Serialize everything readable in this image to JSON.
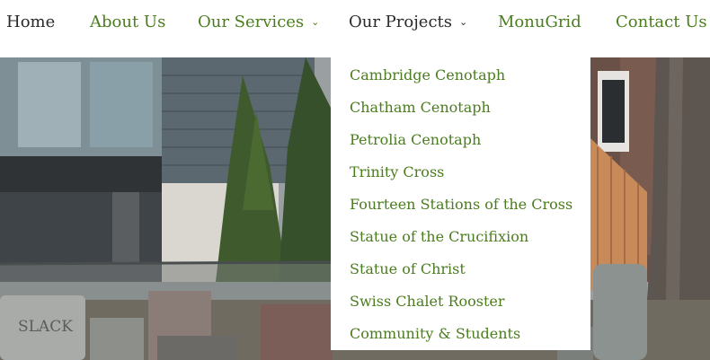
{
  "colors": {
    "accent_green": "#4b7d1e",
    "text_dark": "#2a2a2a",
    "background": "#ffffff"
  },
  "nav": {
    "items": [
      {
        "label": "Home",
        "has_dropdown": false
      },
      {
        "label": "About Us",
        "has_dropdown": false
      },
      {
        "label": "Our Services",
        "has_dropdown": true
      },
      {
        "label": "Our Projects",
        "has_dropdown": true
      },
      {
        "label": "MonuGrid",
        "has_dropdown": false
      },
      {
        "label": "Contact Us",
        "has_dropdown": false
      }
    ],
    "dropdown_icon": "chevron-down-icon"
  },
  "projects_menu": {
    "items": [
      "Cambridge Cenotaph",
      "Chatham Cenotaph",
      "Petrolia Cenotaph",
      "Trinity Cross",
      "Fourteen Stations of the Cross",
      "Statue of the Crucifixion",
      "Statue of Christ",
      "Swiss Chalet Rooster",
      "Community & Students"
    ]
  },
  "hero": {
    "headstone_text": "SLACK"
  }
}
